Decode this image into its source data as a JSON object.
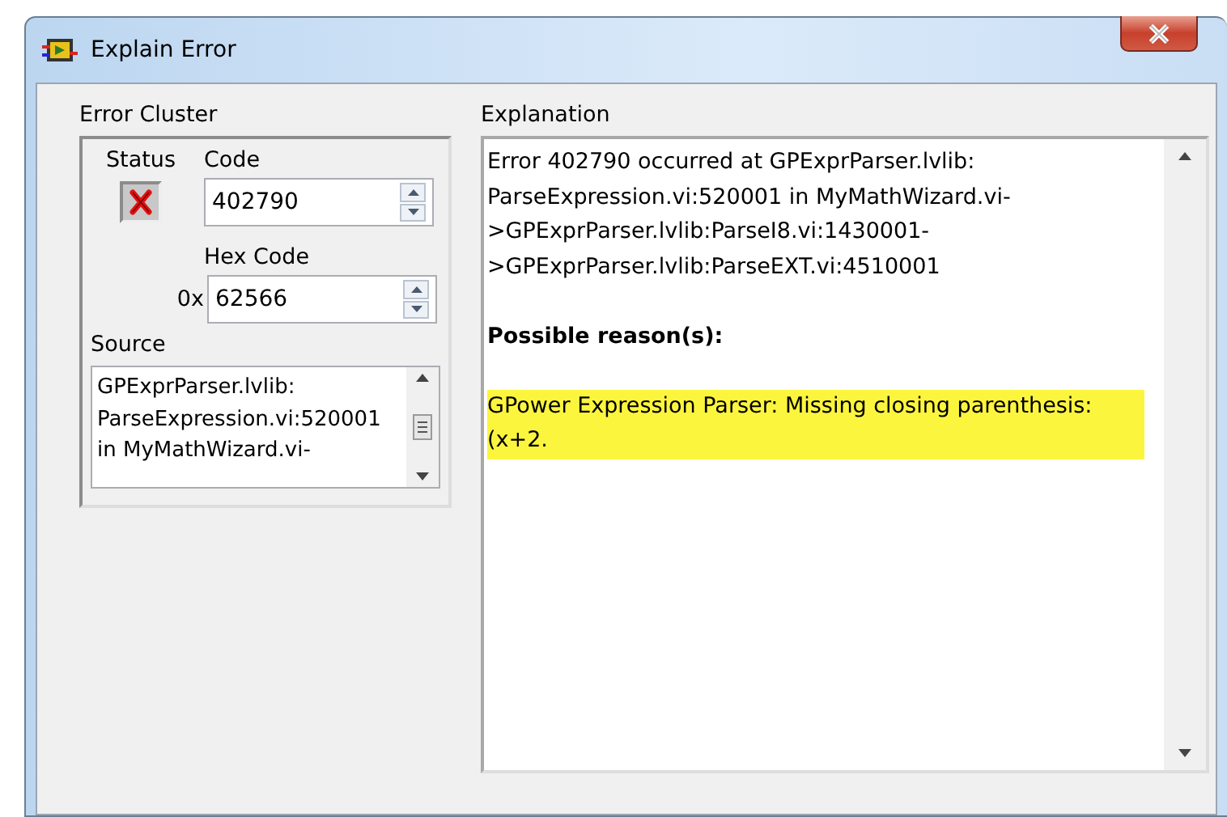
{
  "window": {
    "title": "Explain Error"
  },
  "error_cluster": {
    "label": "Error Cluster",
    "status": {
      "label": "Status",
      "error": true
    },
    "code": {
      "label": "Code",
      "value": "402790"
    },
    "hex_code": {
      "label": "Hex Code",
      "prefix": "0x",
      "value": "62566"
    },
    "source": {
      "label": "Source",
      "lines": [
        "GPExprParser.lvlib:",
        "ParseExpression.vi:520001",
        "in MyMathWizard.vi-"
      ]
    }
  },
  "explanation": {
    "label": "Explanation",
    "paragraphs": [
      {
        "kind": "text",
        "text": "Error 402790 occurred at GPExprParser.lvlib: ParseExpression.vi:520001 in MyMathWizard.vi- >GPExprParser.lvlib:ParseI8.vi:1430001- >GPExprParser.lvlib:ParseEXT.vi:4510001"
      },
      {
        "kind": "heading",
        "text": "Possible reason(s):"
      },
      {
        "kind": "highlight",
        "text": "GPower Expression Parser:  Missing closing parenthesis: (x+2."
      }
    ]
  }
}
